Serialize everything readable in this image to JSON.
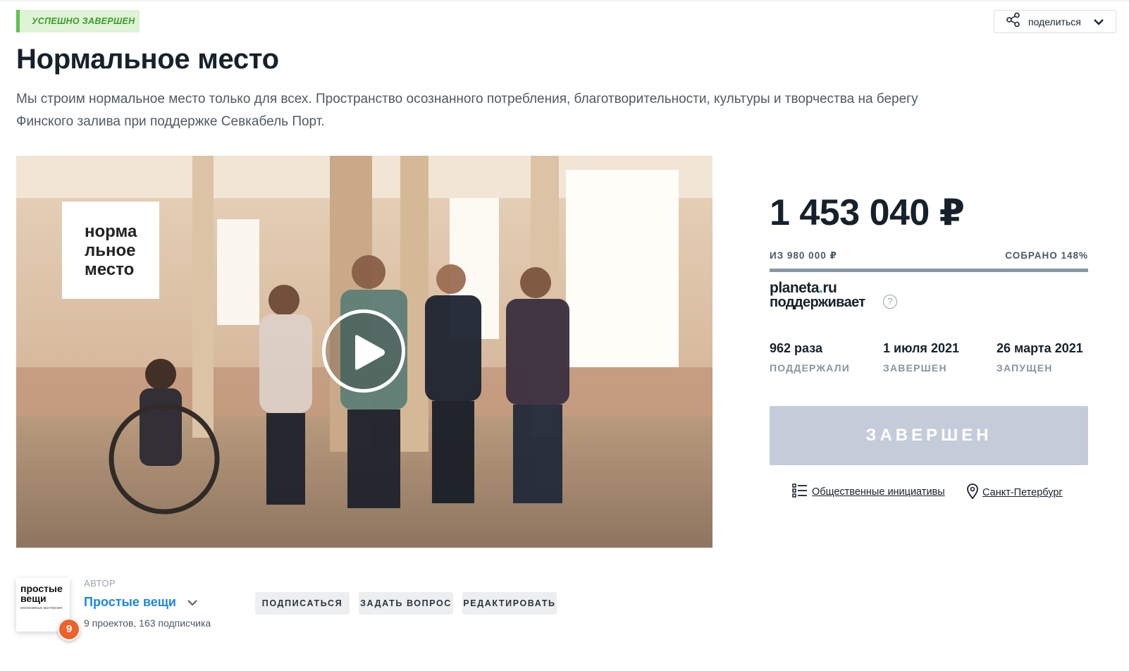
{
  "project": {
    "status": "Успешно завершен",
    "title": "Нормальное место",
    "description": "Мы строим нормальное место только для всех. Пространство осознанного потребления, благотворительности, культуры и творчества на берегу Финского залива при поддержке Севкабель Порт."
  },
  "share": {
    "label": "поделиться"
  },
  "video": {
    "logo_lines": [
      "норма",
      "льное",
      "место"
    ]
  },
  "funding": {
    "amount": "1 453 040 ₽",
    "goal": "из 980 000 ₽",
    "collected": "собрано 148%",
    "progress_fraction": 1.0,
    "planeta_line1": "planeta",
    "planeta_dot": ".",
    "planeta_line1_end": "ru",
    "planeta_line2": "поддерживает",
    "help_glyph": "?"
  },
  "stats": [
    {
      "value": "962 раза",
      "label": "поддержали"
    },
    {
      "value": "1 июля 2021",
      "label": "завершен"
    },
    {
      "value": "26 марта 2021",
      "label": "запущен"
    }
  ],
  "status_button": {
    "label": "Завершен"
  },
  "meta": {
    "category": "Общественные инициативы",
    "category_icon": "list-icon",
    "city": "Санкт-Петербург",
    "city_icon": "map-pin-icon"
  },
  "author": {
    "label": "Автор",
    "name": "Простые вещи",
    "avatar_line1": "простые",
    "avatar_line2": "вещи",
    "avatar_caption": "инклюзивные мастерские",
    "projects_count": "9",
    "summary": "9 проектов, 163 подписчика"
  },
  "actions": {
    "subscribe": "Подписаться",
    "ask": "Задать вопрос",
    "edit": "Редактировать"
  },
  "colors": {
    "accent_blue": "#1f86e3",
    "success_green": "#5cc448",
    "disabled_button": "#c4ccd9",
    "badge_orange": "#f0612c"
  }
}
